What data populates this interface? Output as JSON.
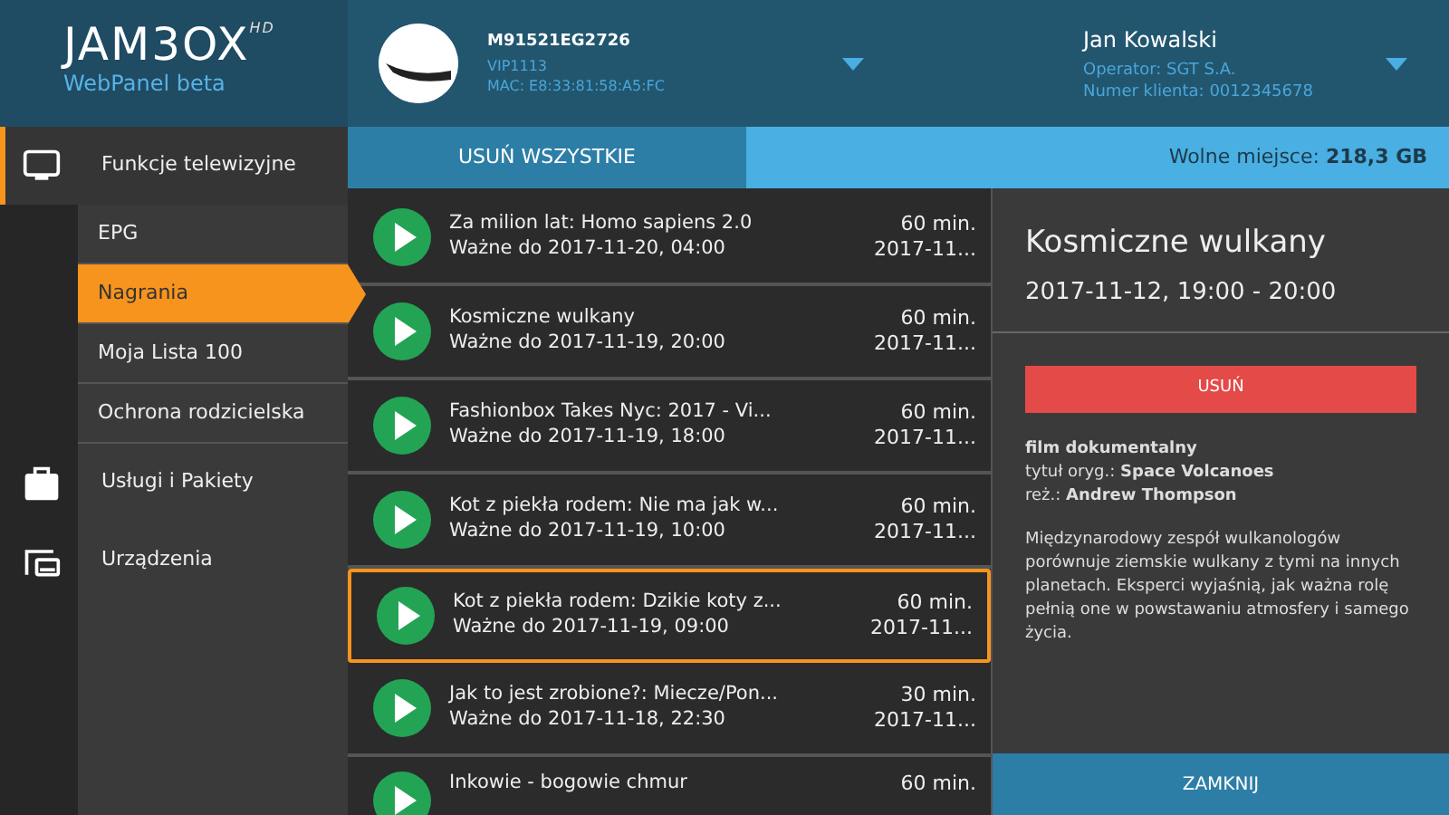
{
  "logo": {
    "brand": "JAM3OX",
    "badge": "HD",
    "subtitle": "WebPanel beta"
  },
  "device": {
    "name": "M91521EG2726",
    "model": "VIP1113",
    "mac": "MAC: E8:33:81:58:A5:FC"
  },
  "user": {
    "name": "Jan Kowalski",
    "operator": "Operator: SGT S.A.",
    "client_number": "Numer klienta: 0012345678"
  },
  "sidebar": {
    "items": [
      {
        "label": "Funkcje telewizyjne",
        "kind": "tv",
        "selected": true,
        "children": [
          {
            "label": "EPG",
            "selected": false
          },
          {
            "label": "Nagrania",
            "selected": true
          },
          {
            "label": "Moja Lista 100",
            "selected": false
          },
          {
            "label": "Ochrona rodzicielska",
            "selected": false
          }
        ]
      },
      {
        "label": "Usługi i Pakiety",
        "kind": "tvcase",
        "selected": false
      },
      {
        "label": "Urządzenia",
        "kind": "devices",
        "selected": false
      }
    ]
  },
  "toolbar": {
    "delete_all": "USUŃ WSZYSTKIE",
    "free_space_label": "Wolne miejsce:",
    "free_space_value": "218,3 GB"
  },
  "recordings": [
    {
      "title": "Za milion lat: Homo sapiens 2.0",
      "valid": "Ważne do 2017-11-20, 04:00",
      "duration": "60 min.",
      "date": "2017-11...",
      "selected": false
    },
    {
      "title": "Kosmiczne wulkany",
      "valid": "Ważne do 2017-11-19, 20:00",
      "duration": "60 min.",
      "date": "2017-11...",
      "selected": false
    },
    {
      "title": "Fashionbox Takes Nyc: 2017 - Vi...",
      "valid": "Ważne do 2017-11-19, 18:00",
      "duration": "60 min.",
      "date": "2017-11...",
      "selected": false
    },
    {
      "title": "Kot z piekła rodem: Nie ma jak w...",
      "valid": "Ważne do 2017-11-19, 10:00",
      "duration": "60 min.",
      "date": "2017-11...",
      "selected": false
    },
    {
      "title": "Kot z piekła rodem: Dzikie koty z...",
      "valid": "Ważne do 2017-11-19, 09:00",
      "duration": "60 min.",
      "date": "2017-11...",
      "selected": true
    },
    {
      "title": "Jak to jest zrobione?: Miecze/Pon...",
      "valid": "Ważne do 2017-11-18, 22:30",
      "duration": "30 min.",
      "date": "2017-11...",
      "selected": false
    },
    {
      "title": "Inkowie - bogowie chmur",
      "duration": "60 min.",
      "selected": false
    }
  ],
  "detail": {
    "title": "Kosmiczne wulkany",
    "time": "2017-11-12, 19:00 - 20:00",
    "delete": "USUŃ",
    "genre": "film dokumentalny",
    "original_title": "tytuł oryg.: **Space Volcanoes**",
    "director": "reż.: **Andrew Thompson**",
    "description": "Międzynarodowy zespół wulkanologów porównuje ziemskie wulkany z tymi na innych planetach. Eksperci wyjaśnią, jak ważna rolę pełnią one w powstawaniu atmosfery i samego życia.",
    "close": "ZAMKNIJ"
  }
}
